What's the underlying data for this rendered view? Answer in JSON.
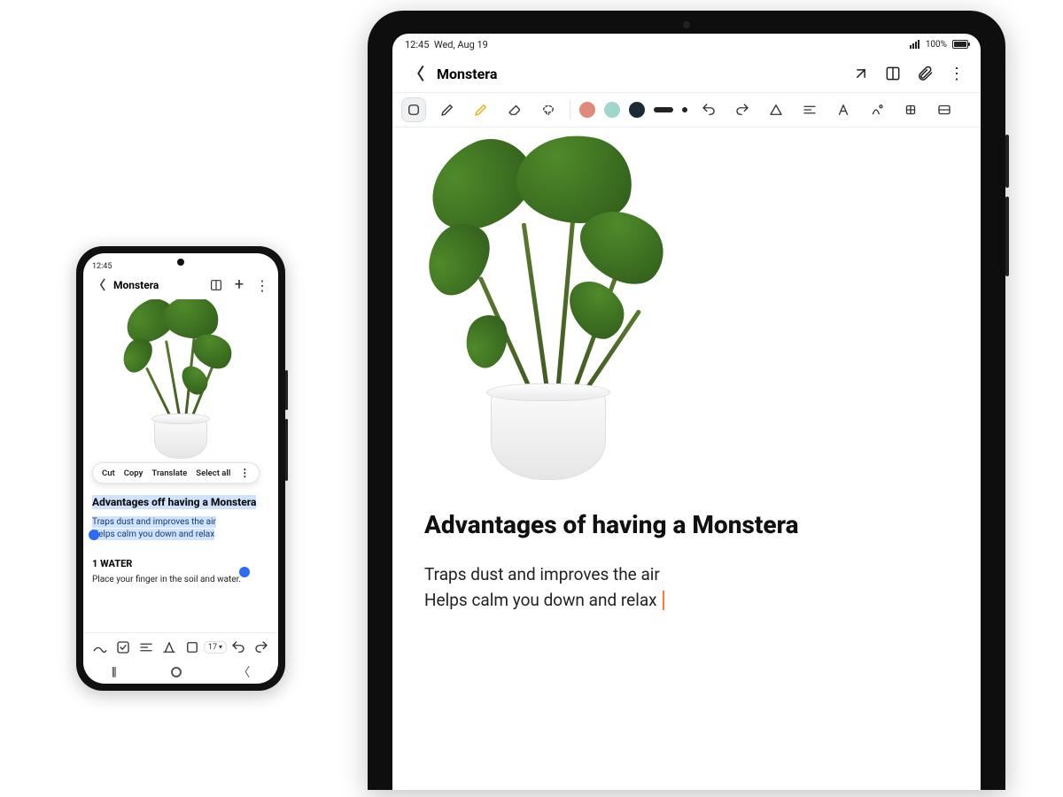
{
  "phone": {
    "status": {
      "time": "12:45"
    },
    "appbar": {
      "title": "Monstera"
    },
    "contextMenu": {
      "cut": "Cut",
      "copy": "Copy",
      "translate": "Translate",
      "selectAll": "Select all"
    },
    "note": {
      "heading": "Advantages off having a Monstera",
      "line1": "Traps dust and improves the air",
      "line2": "Helps calm you down and relax",
      "sectionTitle": "1 WATER",
      "sectionBody": "Place your finger in the soil and water."
    },
    "bottomToolbar": {
      "fontSize": "17"
    }
  },
  "tablet": {
    "status": {
      "time": "12:45",
      "date": "Wed, Aug 19",
      "battery": "100%"
    },
    "appbar": {
      "title": "Monstera"
    },
    "colors": {
      "c1": "#e08a7a",
      "c2": "#9fd7cc",
      "c3": "#1e2a33"
    },
    "note": {
      "heading": "Advantages of having a Monstera",
      "line1": "Traps dust and improves the air",
      "line2": "Helps calm you down and relax"
    }
  }
}
